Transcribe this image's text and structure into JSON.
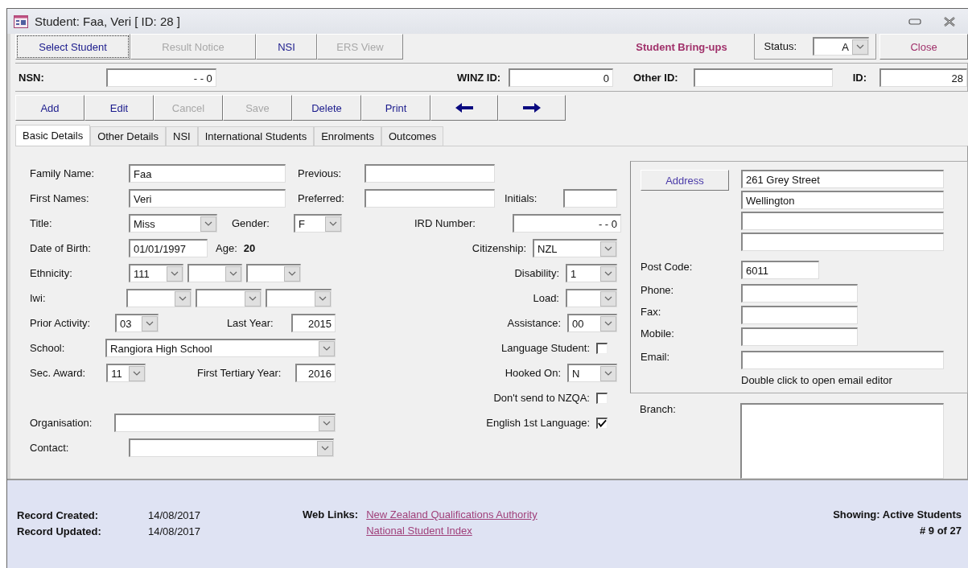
{
  "window": {
    "title": "Student: Faa, Veri [ ID: 28 ]"
  },
  "top_buttons": [
    {
      "label": "Select Student",
      "disabled": false,
      "focused": true
    },
    {
      "label": "Result Notice",
      "disabled": true,
      "focused": false
    },
    {
      "label": "NSI",
      "disabled": false,
      "focused": false
    },
    {
      "label": "ERS View",
      "disabled": true,
      "focused": false
    }
  ],
  "bring_ups": "Student Bring-ups",
  "status": {
    "label": "Status:",
    "value": "A"
  },
  "close_button": "Close",
  "id_row": [
    {
      "label": "NSN:",
      "value": "- - 0"
    },
    {
      "label": "WINZ ID:",
      "value": "0"
    },
    {
      "label": "Other ID:"
    },
    {
      "label": "ID:",
      "value": "28"
    }
  ],
  "toolbar": [
    {
      "kind": "text",
      "label": "Add",
      "disabled": false
    },
    {
      "kind": "text",
      "label": "Edit",
      "disabled": false
    },
    {
      "kind": "text",
      "label": "Cancel",
      "disabled": true
    },
    {
      "kind": "text",
      "label": "Save",
      "disabled": true
    },
    {
      "kind": "text",
      "label": "Delete",
      "disabled": false
    },
    {
      "kind": "text",
      "label": "Print",
      "disabled": false
    },
    {
      "kind": "prev",
      "disabled": false
    },
    {
      "kind": "next",
      "disabled": false
    }
  ],
  "tabs": [
    {
      "label": "Basic Details",
      "selected": true
    },
    {
      "label": "Other Details",
      "selected": false
    },
    {
      "label": "NSI",
      "selected": false
    },
    {
      "label": "International Students",
      "selected": false
    },
    {
      "label": "Enrolments",
      "selected": false
    },
    {
      "label": "Outcomes",
      "selected": false
    }
  ],
  "form": {
    "family_name": {
      "label": "Family Name:",
      "value": "Faa"
    },
    "previous": {
      "label": "Previous:"
    },
    "first_names": {
      "label": "First Names:",
      "value": "Veri"
    },
    "preferred": {
      "label": "Preferred:"
    },
    "initials": {
      "label": "Initials:"
    },
    "title": {
      "label": "Title:",
      "value": "Miss"
    },
    "gender": {
      "label": "Gender:",
      "value": "F"
    },
    "ird_number": {
      "label": "IRD Number:",
      "value": "- - 0"
    },
    "date_of_birth": {
      "label": "Date of Birth:",
      "value": "01/01/1997"
    },
    "age": {
      "label": "Age:",
      "value": "20"
    },
    "citizenship": {
      "label": "Citizenship:",
      "value": "NZL"
    },
    "ethnicity": {
      "label": "Ethnicity:",
      "values": [
        "111"
      ]
    },
    "disability": {
      "label": "Disability:",
      "value": "1"
    },
    "iwi": {
      "label": "Iwi:"
    },
    "load": {
      "label": "Load:"
    },
    "prior_activity": {
      "label": "Prior Activity:",
      "value": "03"
    },
    "last_year": {
      "label": "Last Year:",
      "value": "2015"
    },
    "assistance": {
      "label": "Assistance:",
      "value": "00"
    },
    "school": {
      "label": "School:",
      "value": "Rangiora High School"
    },
    "language_student": {
      "label": "Language Student:",
      "checked": false
    },
    "sec_award": {
      "label": "Sec. Award:",
      "value": "11"
    },
    "first_tertiary_year": {
      "label": "First Tertiary Year:",
      "value": "2016"
    },
    "hooked_on": {
      "label": "Hooked On:",
      "value": "N"
    },
    "dont_send_nzqa": {
      "label": "Don't send to NZQA:",
      "checked": false
    },
    "organisation": {
      "label": "Organisation:"
    },
    "english_first": {
      "label": "English 1st Language:",
      "checked": true
    },
    "contact": {
      "label": "Contact:"
    }
  },
  "address": {
    "button": "Address",
    "lines": [
      "261 Grey Street",
      "Wellington"
    ],
    "post_code": {
      "label": "Post Code:",
      "value": "6011"
    },
    "phone": {
      "label": "Phone:"
    },
    "fax": {
      "label": "Fax:"
    },
    "mobile": {
      "label": "Mobile:"
    },
    "email": {
      "label": "Email:"
    },
    "email_hint": "Double click to open email editor"
  },
  "branch": {
    "label": "Branch:"
  },
  "footer": {
    "record_created": {
      "label": "Record Created:",
      "value": "14/08/2017"
    },
    "record_updated": {
      "label": "Record Updated:",
      "value": "14/08/2017"
    },
    "web_links": {
      "label": "Web Links:",
      "links": [
        "New Zealand Qualifications Authority",
        "National Student Index"
      ]
    },
    "showing": "Showing: Active Students",
    "record_count": "# 9 of 27"
  }
}
